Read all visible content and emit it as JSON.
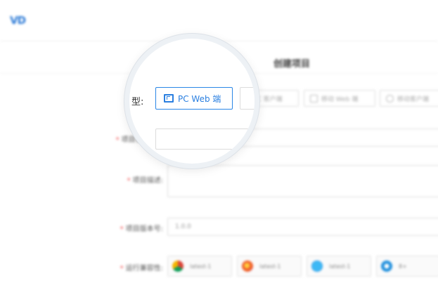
{
  "header": {
    "logo_text": "VD"
  },
  "page": {
    "title": "创建项目"
  },
  "form": {
    "type_label": "类型:",
    "type_options": [
      {
        "label": "PC Web 端",
        "icon": "pc-web-icon",
        "selected": true
      },
      {
        "label": "PC 客户端",
        "icon": "pc-client-icon",
        "selected": false
      },
      {
        "label": "移动 Web 端",
        "icon": "mobile-icon",
        "selected": false
      },
      {
        "label": "移动客户端",
        "icon": "android-icon",
        "selected": false
      }
    ],
    "name_label": "项目名称:",
    "desc_label": "项目描述:",
    "version_label": "项目版本号:",
    "version_value": "1.0.0",
    "browser_label": "运行兼容性:",
    "browsers": [
      {
        "icon": "chrome-icon",
        "value": "latest-1"
      },
      {
        "icon": "firefox-icon",
        "value": "latest-1"
      },
      {
        "icon": "safari-icon",
        "value": "latest-1"
      },
      {
        "icon": "ie-icon",
        "value": "8+"
      }
    ],
    "required_mark": "*"
  },
  "lens": {
    "label_char": "型:",
    "selected_option": "PC Web 端"
  },
  "colors": {
    "accent": "#2a7fe0",
    "required": "#e44444"
  }
}
